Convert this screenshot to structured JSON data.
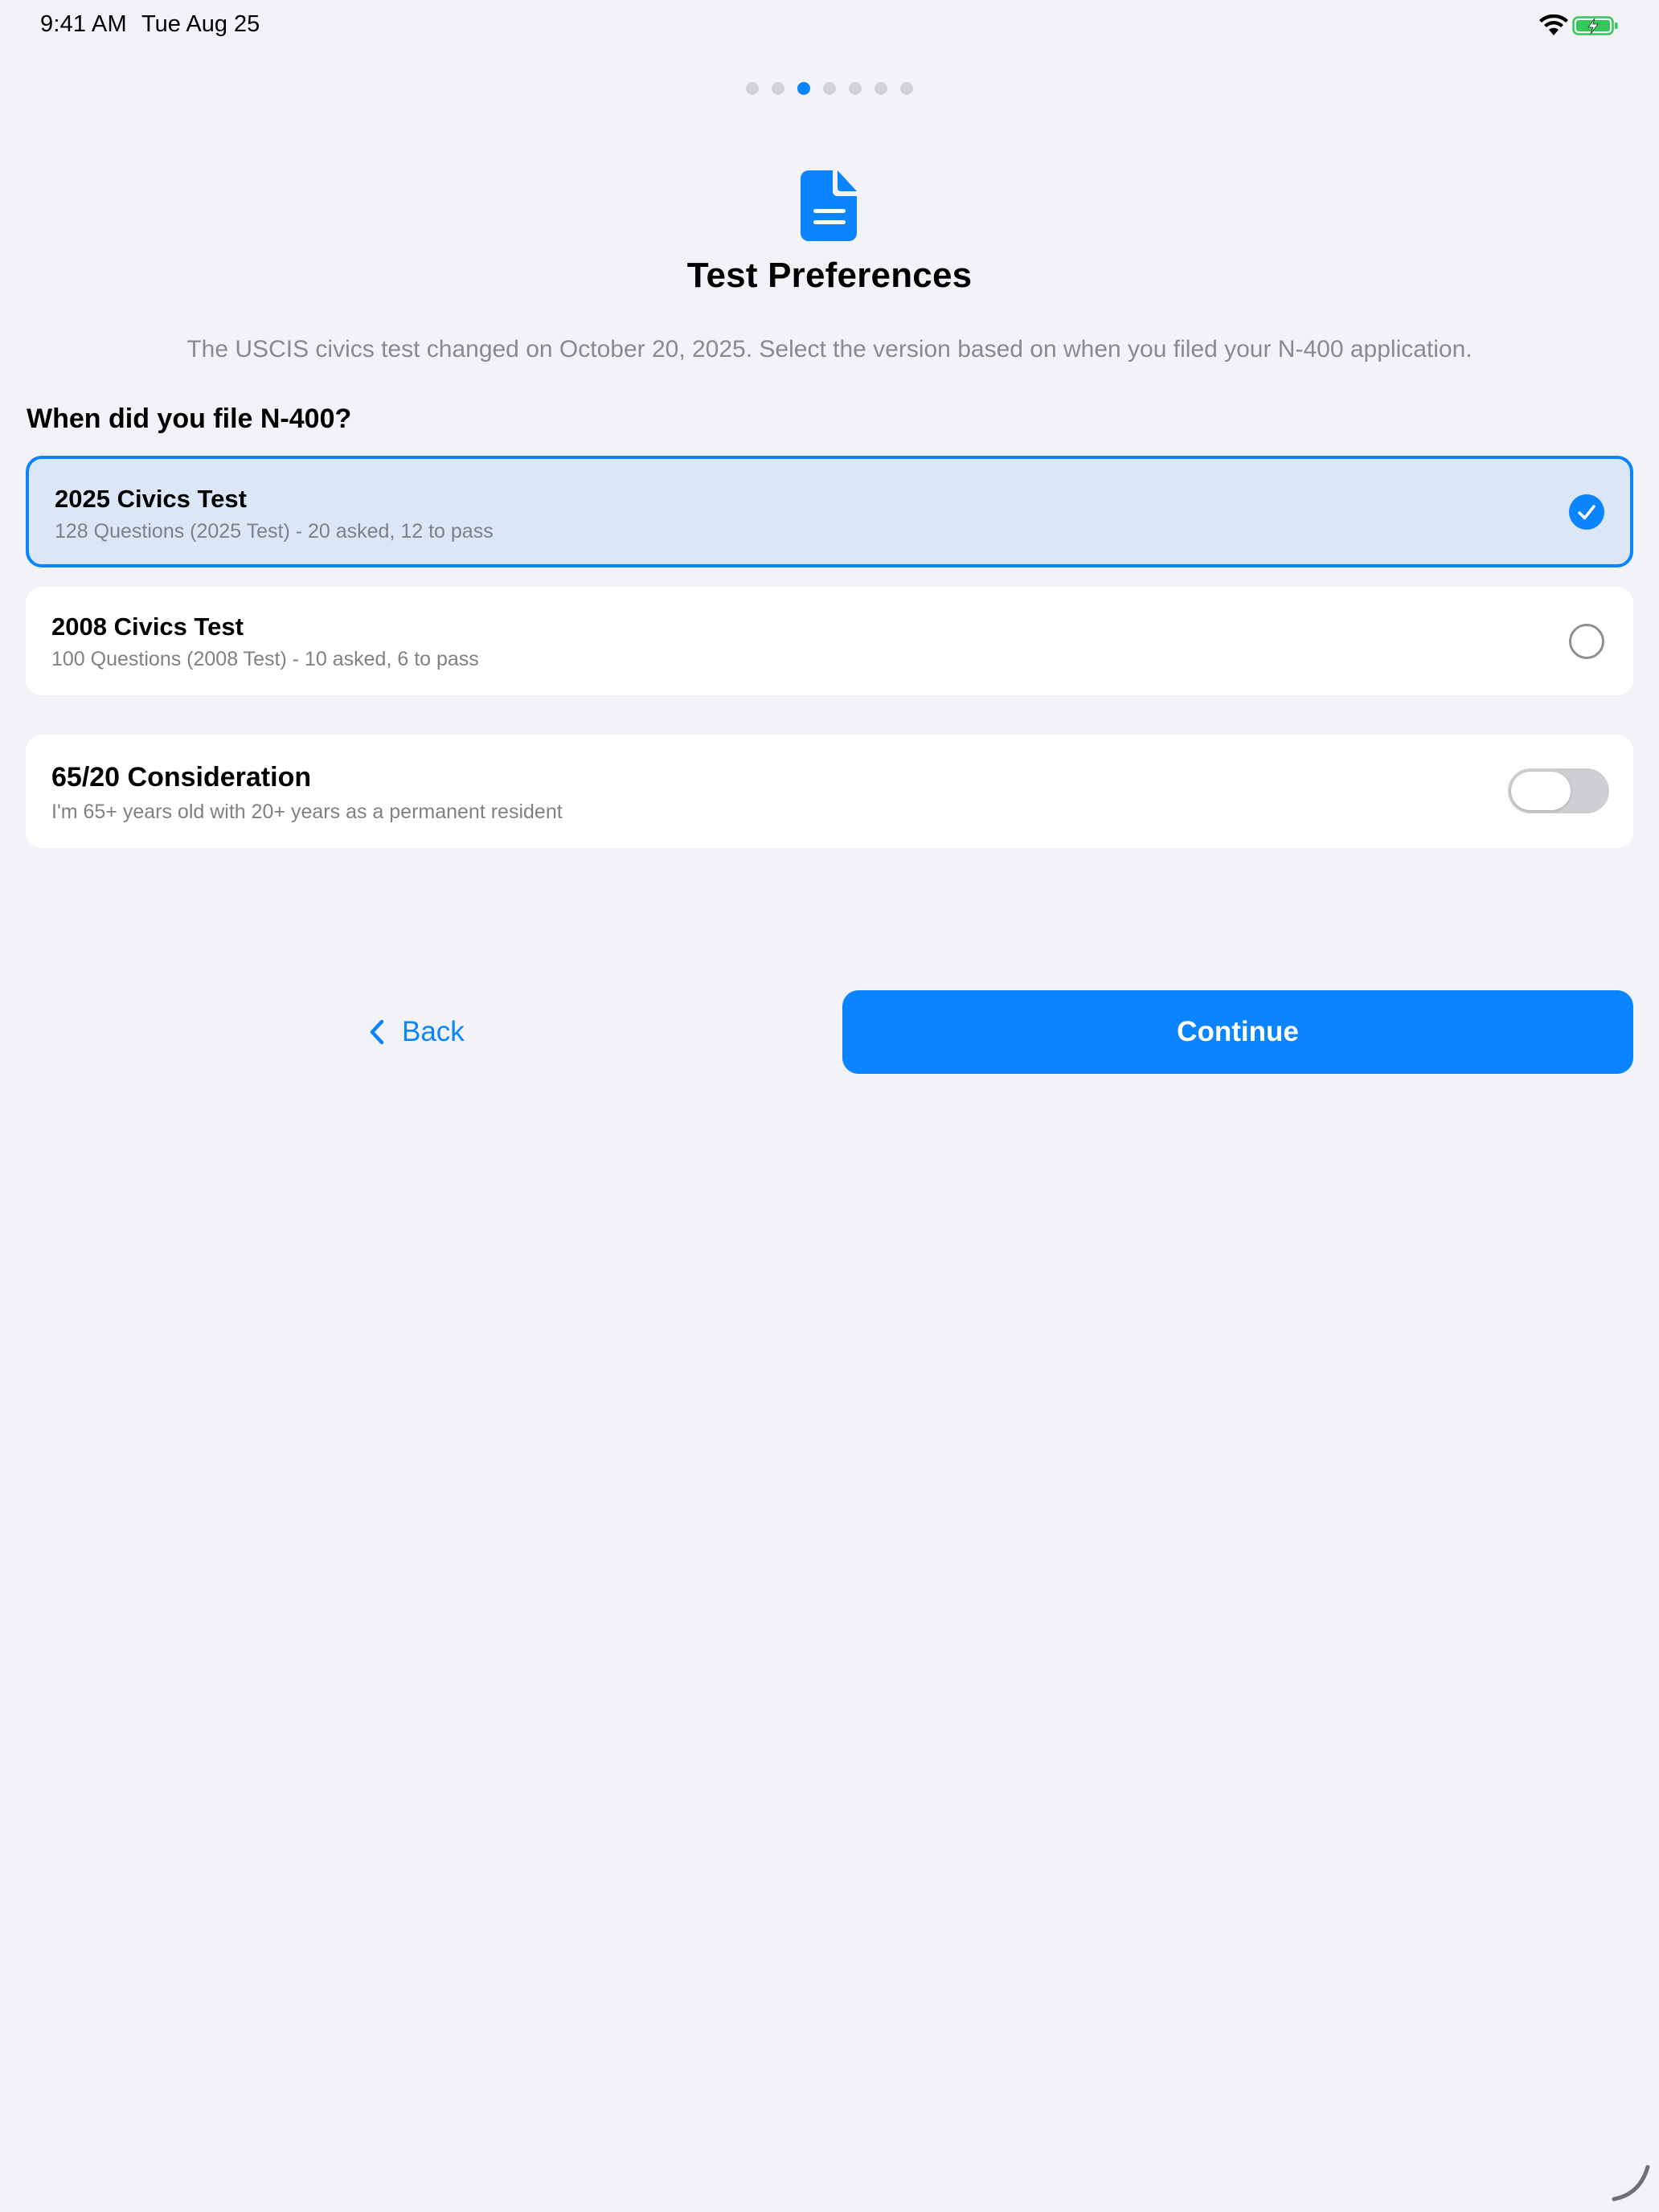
{
  "status_bar": {
    "time": "9:41 AM",
    "date": "Tue Aug 25",
    "icons": [
      "wifi-icon",
      "battery-charging-icon"
    ]
  },
  "onboarding": {
    "page_count": 7,
    "current_page": 3
  },
  "header": {
    "icon": "document-icon",
    "title": "Test Preferences",
    "description": "The USCIS civics test changed on October 20, 2025. Select the version based on when you filed your N-400 application."
  },
  "question": "When did you file N-400?",
  "options": [
    {
      "title": "2025 Civics Test",
      "subtitle": "128 Questions (2025 Test) - 20 asked, 12 to pass",
      "selected": true
    },
    {
      "title": "2008 Civics Test",
      "subtitle": "100 Questions (2008 Test) - 10 asked, 6 to pass",
      "selected": false
    }
  ],
  "consideration": {
    "title": "65/20 Consideration",
    "subtitle": "I'm 65+ years old with 20+ years as a permanent resident",
    "enabled": false
  },
  "footer": {
    "back_label": "Back",
    "continue_label": "Continue"
  },
  "colors": {
    "accent": "#0a84ff",
    "background": "#f2f2f7",
    "selected_card": "#dbe6f6"
  }
}
